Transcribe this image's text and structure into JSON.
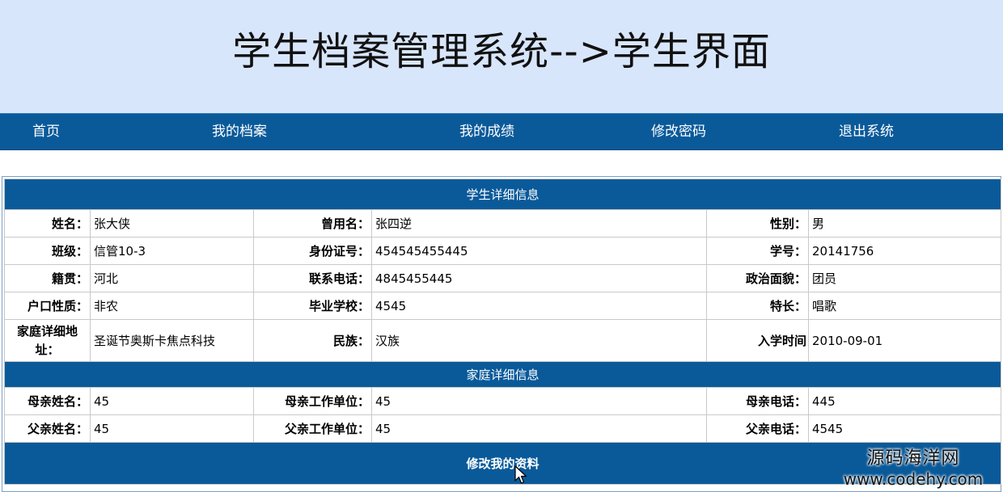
{
  "header": {
    "title": "学生档案管理系统-->学生界面"
  },
  "nav": [
    {
      "label": "首页"
    },
    {
      "label": "我的档案"
    },
    {
      "label": "我的成绩"
    },
    {
      "label": "修改密码"
    },
    {
      "label": "退出系统"
    }
  ],
  "student_section": {
    "title": "学生详细信息",
    "rows": [
      [
        {
          "label": "姓名：",
          "value": "张大侠"
        },
        {
          "label": "曾用名：",
          "value": "张四逆"
        },
        {
          "label": "性别：",
          "value": "男"
        }
      ],
      [
        {
          "label": "班级：",
          "value": "信管10-3"
        },
        {
          "label": "身份证号：",
          "value": "454545455445"
        },
        {
          "label": "学号：",
          "value": "20141756"
        }
      ],
      [
        {
          "label": "籍贯：",
          "value": "河北"
        },
        {
          "label": "联系电话：",
          "value": "4845455445"
        },
        {
          "label": "政治面貌：",
          "value": "团员"
        }
      ],
      [
        {
          "label": "户口性质：",
          "value": "非农"
        },
        {
          "label": "毕业学校：",
          "value": "4545"
        },
        {
          "label": "特长：",
          "value": "唱歌"
        }
      ],
      [
        {
          "label": "家庭详细地址：",
          "value": "圣诞节奥斯卡焦点科技"
        },
        {
          "label": "民族：",
          "value": "汉族"
        },
        {
          "label": "入学时间",
          "value": "2010-09-01"
        }
      ]
    ]
  },
  "family_section": {
    "title": "家庭详细信息",
    "rows": [
      [
        {
          "label": "母亲姓名：",
          "value": "45"
        },
        {
          "label": "母亲工作单位：",
          "value": "45"
        },
        {
          "label": "母亲电话：",
          "value": "445"
        }
      ],
      [
        {
          "label": "父亲姓名：",
          "value": "45"
        },
        {
          "label": "父亲工作单位：",
          "value": "45"
        },
        {
          "label": "父亲电话：",
          "value": "4545"
        }
      ]
    ]
  },
  "action": {
    "label": "修改我的资料"
  },
  "watermark": {
    "line1": "源码海洋网",
    "line2": "www.codehy.com"
  },
  "colors": {
    "header_bg": "#d8e6fb",
    "nav_bg": "#0a5a9a",
    "section_bg": "#0a5a9a",
    "border": "#c9c9c9"
  },
  "icons": {
    "cursor": "mouse-pointer-icon"
  }
}
